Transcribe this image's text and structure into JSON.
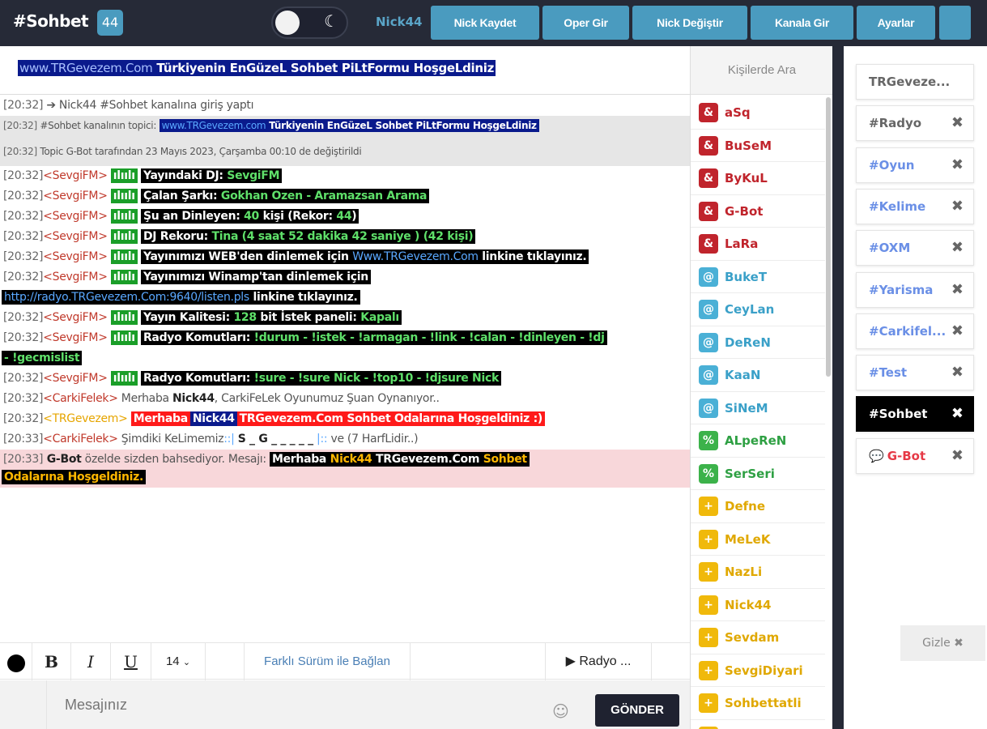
{
  "header": {
    "title": "#Sohbet",
    "user_count": "44",
    "nick": "Nick44",
    "buttons": [
      "Nick Kaydet",
      "Oper Gir",
      "Nick Değiştir",
      "Kanala Gir",
      "Ayarlar"
    ]
  },
  "topic": {
    "url": "www.TRGevezem.Com",
    "text": " Türkiyenin EnGüzeL Sohbet PiLtFormu HoşgeLdiniz"
  },
  "messages": {
    "m1": {
      "ts": "[20:32]",
      "arrow": "➔",
      "text": " Nick44 #Sohbet kanalına giriş yaptı"
    },
    "m2": {
      "ts": "[20:32]",
      "prefix": " #Sohbet kanalının topici: ",
      "url": "www.TRGevezem.com",
      "text": " Türkiyenin EnGüzeL Sohbet PiLtFormu HoşgeLdiniz"
    },
    "m3": {
      "ts": "[20:32]",
      "text": " Topic G-Bot tarafından 23 Mayıs 2023, Çarşamba 00:10 de değiştirildi"
    },
    "r1": {
      "ts": "[20:32]",
      "nick": "<SevgiFM>",
      "tag": "ılıılı",
      "label": "Yayındaki DJ: ",
      "val": "SevgiFM"
    },
    "r2": {
      "ts": "[20:32]",
      "nick": "<SevgiFM>",
      "tag": "ılıılı",
      "label": "Çalan Şarkı: ",
      "val": "Gokhan Ozen -  Aramazsan Arama"
    },
    "r3": {
      "ts": "[20:32]",
      "nick": "<SevgiFM>",
      "tag": "ılıılı",
      "label": "Şu an Dinleyen: ",
      "v1": "40",
      "mid": " kişi (Rekor: ",
      "v2": "44",
      "end": ")"
    },
    "r4": {
      "ts": "[20:32]",
      "nick": "<SevgiFM>",
      "tag": "ılıılı",
      "label": "DJ Rekoru: ",
      "val": "Tina (4 saat 52 dakika 42 saniye ) (42 kişi)"
    },
    "r5": {
      "ts": "[20:32]",
      "nick": "<SevgiFM>",
      "tag": "ılıılı",
      "label": "Yayınımızı WEB'den dinlemek için ",
      "url": "Www.TRGevezem.Com",
      "end": " linkine tıklayınız."
    },
    "r6": {
      "ts": "[20:32]",
      "nick": "<SevgiFM>",
      "tag": "ılıılı",
      "label": "Yayınımızı Winamp'tan dinlemek için ",
      "url": "http://radyo.TRGevezem.Com:9640/listen.pls",
      "end": " linkine tıklayınız."
    },
    "r7": {
      "ts": "[20:32]",
      "nick": "<SevgiFM>",
      "tag": "ılıılı",
      "label": "Yayın Kalitesi: ",
      "v1": "128",
      "mid": " bit  İstek paneli: ",
      "v2": "Kapalı"
    },
    "r8": {
      "ts": "[20:32]",
      "nick": "<SevgiFM>",
      "tag": "ılıılı",
      "label": "Radyo Komutları: ",
      "val": "!durum - !istek - !armagan - !link - !calan - !dinleyen - !dj",
      "val2": "- !gecmislist"
    },
    "r9": {
      "ts": "[20:32]",
      "nick": "<SevgiFM>",
      "tag": "ılıılı",
      "label": "Radyo Komutları: ",
      "val": "!sure - !sure Nick - !top10 - !djsure Nick"
    },
    "c1": {
      "ts": "[20:32]",
      "nick": "<CarkiFelek>",
      "pre": " Merhaba ",
      "bold": "Nick44",
      "post": ", CarkiFeLek Oyunumuz Şuan Oynanıyor.."
    },
    "t1": {
      "ts": "[20:32]",
      "nick": "<TRGevezem>",
      "a": "Merhaba",
      "b": "Nick44",
      "c": "TRGevezem.Com Sohbet Odalarına Hoşgeldiniz :)"
    },
    "c2": {
      "ts": "[20:33]",
      "nick": "<CarkiFelek>",
      "pre": " Şimdiki KeLimemiz",
      "dots": "::|",
      "word": "S _ G _ _ _ _ _",
      "dots2": "|::",
      "post": " ve (7 HarfLidir..)"
    },
    "p1": {
      "ts": "[20:33]",
      "bold": " G-Bot",
      "pre": " özelde sizden bahsediyor. Mesajı: ",
      "a": "Merhaba ",
      "b": "Nick44",
      "c": " TRGevezem.Com ",
      "d": "Sohbet",
      "e": "Odalarına Hoşgeldiniz."
    }
  },
  "toolbar": {
    "bold": "B",
    "italic": "I",
    "underline": "U",
    "font_size": "14",
    "alt_connect": "Farklı Sürüm ile Bağlan",
    "radio": "▶ Radyo ..."
  },
  "input": {
    "placeholder": "Mesajınız",
    "send": "GÖNDER"
  },
  "users": {
    "search_placeholder": "Kişilerde Ara",
    "list": [
      {
        "name": "aSq",
        "icon": "&",
        "color": "#c0242c",
        "icon_bg": "#c0242c"
      },
      {
        "name": "BuSeM",
        "icon": "&",
        "color": "#c0242c",
        "icon_bg": "#c0242c"
      },
      {
        "name": "ByKuL",
        "icon": "&",
        "color": "#c0242c",
        "icon_bg": "#c0242c"
      },
      {
        "name": "G-Bot",
        "icon": "&",
        "color": "#c0242c",
        "icon_bg": "#c0242c"
      },
      {
        "name": "LaRa",
        "icon": "&",
        "color": "#c0242c",
        "icon_bg": "#c0242c"
      },
      {
        "name": "BukeT",
        "icon": "@",
        "color": "#3aa0c8",
        "icon_bg": "#4ab0d6"
      },
      {
        "name": "CeyLan",
        "icon": "@",
        "color": "#3aa0c8",
        "icon_bg": "#4ab0d6"
      },
      {
        "name": "DeReN",
        "icon": "@",
        "color": "#3aa0c8",
        "icon_bg": "#4ab0d6"
      },
      {
        "name": "KaaN",
        "icon": "@",
        "color": "#3aa0c8",
        "icon_bg": "#4ab0d6"
      },
      {
        "name": "SiNeM",
        "icon": "@",
        "color": "#3aa0c8",
        "icon_bg": "#4ab0d6"
      },
      {
        "name": "ALpeReN",
        "icon": "%",
        "color": "#2ea043",
        "icon_bg": "#3cb24a"
      },
      {
        "name": "SerSeri",
        "icon": "%",
        "color": "#2ea043",
        "icon_bg": "#3cb24a"
      },
      {
        "name": "Defne",
        "icon": "+",
        "color": "#e0a800",
        "icon_bg": "#f0b90b"
      },
      {
        "name": "MeLeK",
        "icon": "+",
        "color": "#e0a800",
        "icon_bg": "#f0b90b"
      },
      {
        "name": "NazLi",
        "icon": "+",
        "color": "#e0a800",
        "icon_bg": "#f0b90b"
      },
      {
        "name": "Nick44",
        "icon": "+",
        "color": "#e0a800",
        "icon_bg": "#f0b90b"
      },
      {
        "name": "Sevdam",
        "icon": "+",
        "color": "#e0a800",
        "icon_bg": "#f0b90b"
      },
      {
        "name": "SevgiDiyari",
        "icon": "+",
        "color": "#e0a800",
        "icon_bg": "#f0b90b"
      },
      {
        "name": "Sohbettatli",
        "icon": "+",
        "color": "#e0a800",
        "icon_bg": "#f0b90b"
      },
      {
        "name": "",
        "icon": "+",
        "color": "#e0a800",
        "icon_bg": "#f0b90b"
      }
    ]
  },
  "channels": {
    "list": [
      {
        "name": "TRGeveze...",
        "close": "",
        "color": "#666666",
        "active": false
      },
      {
        "name": "#Radyo",
        "close": "✖",
        "color": "#666666",
        "active": false
      },
      {
        "name": "#Oyun",
        "close": "✖",
        "color": "#6a8fe6",
        "active": false
      },
      {
        "name": "#Kelime",
        "close": "✖",
        "color": "#6a8fe6",
        "active": false
      },
      {
        "name": "#OXM",
        "close": "✖",
        "color": "#6a8fe6",
        "active": false
      },
      {
        "name": "#Yarisma",
        "close": "✖",
        "color": "#6a8fe6",
        "active": false
      },
      {
        "name": "#Carkifel...",
        "close": "✖",
        "color": "#6a8fe6",
        "active": false
      },
      {
        "name": "#Test",
        "close": "✖",
        "color": "#6a8fe6",
        "active": false
      },
      {
        "name": "#Sohbet",
        "close": "✖",
        "color": "#ffffff",
        "active": true
      },
      {
        "name": "G-Bot",
        "close": "✖",
        "color": "#e63946",
        "active": false,
        "bubble": "💬"
      }
    ],
    "hide": "Gizle ✖"
  }
}
